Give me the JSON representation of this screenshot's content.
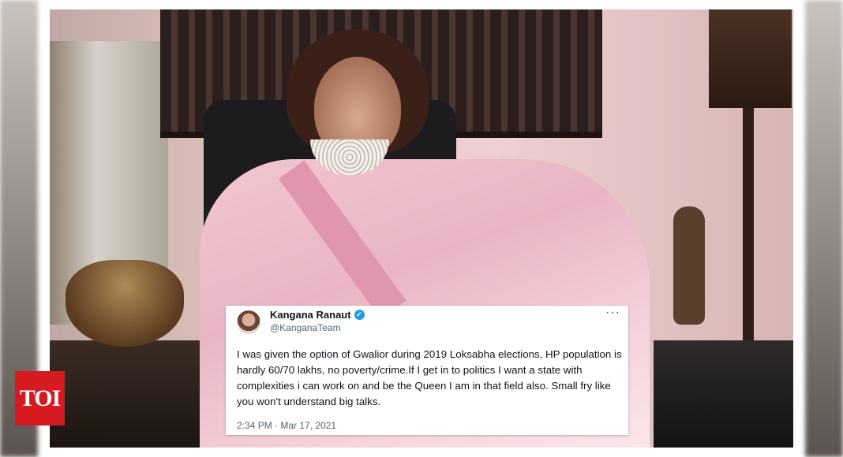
{
  "badge": {
    "text": "TOI",
    "color": "#d71920"
  },
  "tweet": {
    "author_name": "Kangana Ranaut",
    "verified_icon": "verified-check-icon",
    "handle": "@KanganaTeam",
    "more_icon": "more-options-icon",
    "more_glyph": "···",
    "body": "I was given the option of Gwalior during 2019 Loksabha elections, HP population is hardly 60/70 lakhs, no poverty/crime.If I get in to politics I want a state with complexities i can work on and be the Queen I am in that field also. Small fry like you won't understand big talks.",
    "timestamp": "2:34 PM · Mar 17, 2021",
    "verified_color": "#1d9bf0"
  }
}
